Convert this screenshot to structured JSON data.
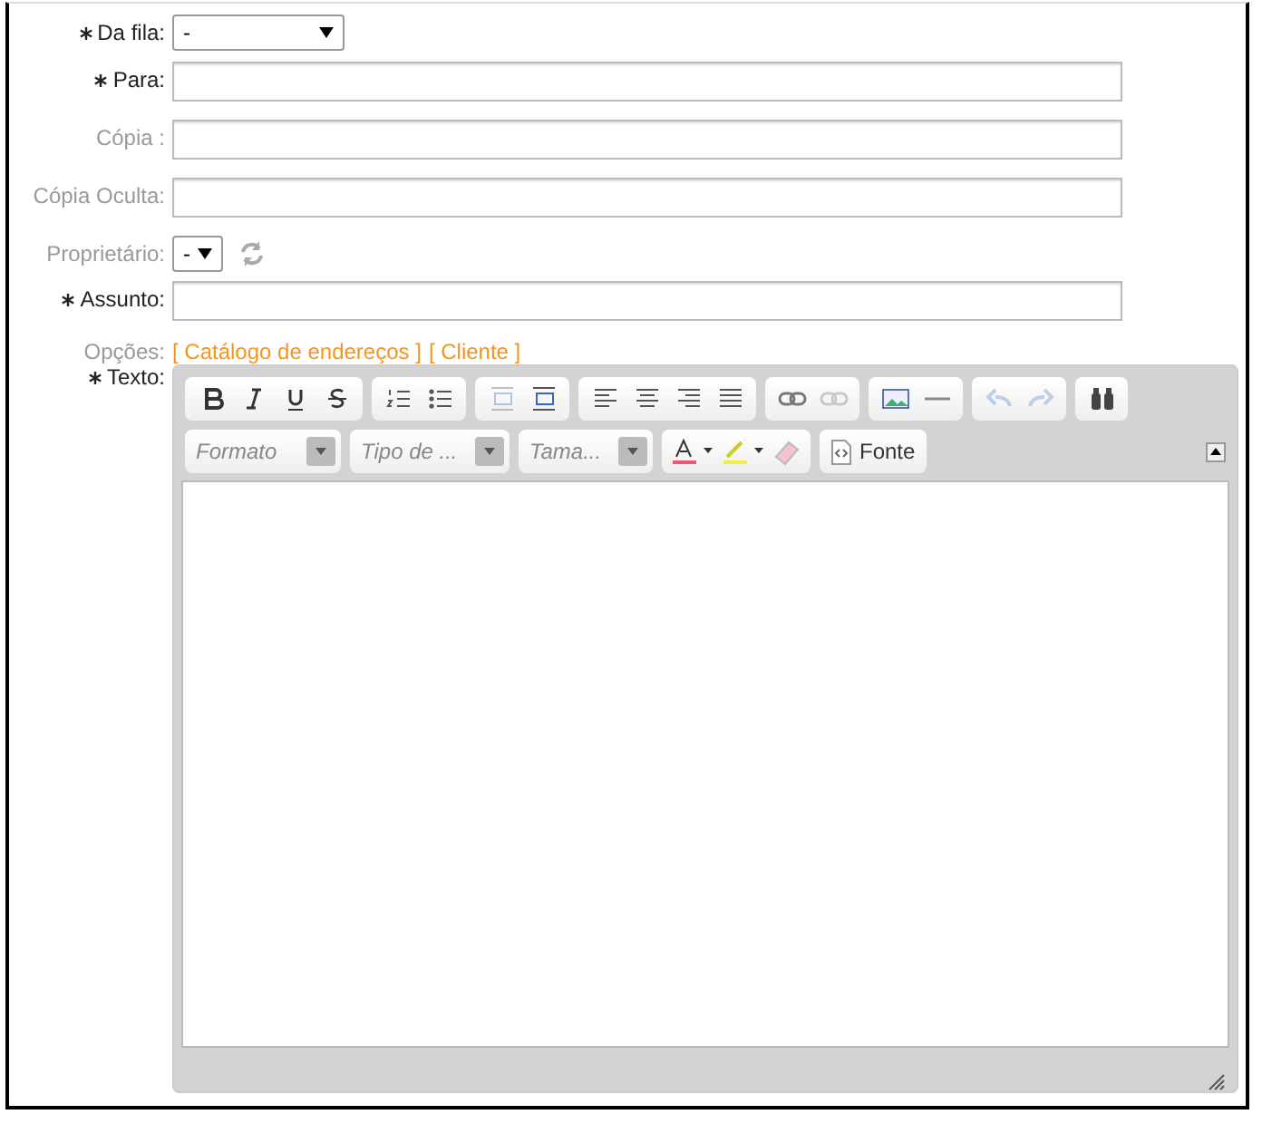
{
  "fields": [
    {
      "label": "Da fila:",
      "option": "-",
      "required": true,
      "kind": "select"
    },
    {
      "label": "Para:",
      "required": true,
      "kind": "text"
    },
    {
      "label": "Cópia :",
      "required": false,
      "kind": "text"
    },
    {
      "label": "Cópia Oculta:",
      "required": false,
      "kind": "text"
    },
    {
      "label": "Proprietário:",
      "option": "-",
      "required": false,
      "kind": "owner"
    },
    {
      "label": "Assunto:",
      "required": true,
      "kind": "text"
    },
    {
      "label": "Opções:",
      "required": false,
      "kind": "links",
      "links": [
        "[ Catálogo de endereços ]",
        "[ Cliente ]"
      ]
    },
    {
      "label": "Texto:",
      "required": true,
      "kind": "editor"
    }
  ],
  "toolbar": {
    "row_1": [
      [
        {
          "kind": "bold",
          "disabled": false
        },
        {
          "kind": "italic",
          "disabled": false
        },
        {
          "kind": "underline",
          "disabled": false
        },
        {
          "kind": "strike",
          "disabled": false
        }
      ],
      [
        {
          "kind": "numbered-list",
          "disabled": false
        },
        {
          "kind": "bulleted-list",
          "disabled": false
        }
      ],
      [
        {
          "kind": "outdent",
          "disabled": true
        },
        {
          "kind": "indent",
          "disabled": false
        }
      ],
      [
        {
          "kind": "align-left",
          "disabled": false
        },
        {
          "kind": "align-center",
          "disabled": false
        },
        {
          "kind": "align-right",
          "disabled": false
        },
        {
          "kind": "justify",
          "disabled": false
        }
      ],
      [
        {
          "kind": "link",
          "disabled": false
        },
        {
          "kind": "unlink",
          "disabled": true
        }
      ],
      [
        {
          "kind": "image",
          "disabled": false
        },
        {
          "kind": "rule",
          "disabled": false
        }
      ],
      [
        {
          "kind": "undo",
          "disabled": true
        },
        {
          "kind": "redo",
          "disabled": true
        }
      ],
      [
        {
          "kind": "find",
          "disabled": false
        }
      ]
    ],
    "combos": [
      "Formato",
      "Tipo de ...",
      "Tama..."
    ],
    "source_button": "Fonte"
  }
}
